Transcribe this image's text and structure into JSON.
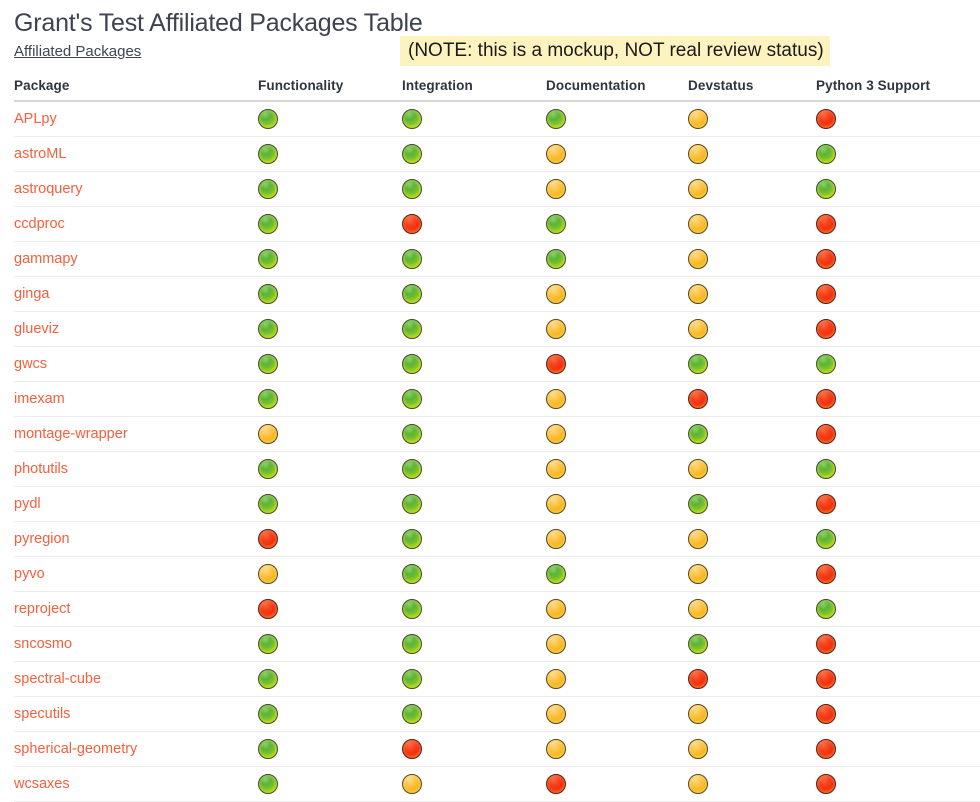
{
  "header": {
    "title": "Grant's Test Affiliated Packages Table",
    "breadcrumb_link": "Affiliated Packages",
    "note": "(NOTE: this is a mockup, NOT real review status)"
  },
  "colors": {
    "package_link": "#f4603e",
    "breadcrumb_link": "#3c4654",
    "note_background": "#fdf3bf",
    "green": "#6fc02c",
    "yellow": "#f5b31d",
    "red": "#ef2d0d",
    "header_rule": "#d6d6d6",
    "row_rule": "#ededed"
  },
  "table": {
    "columns": [
      "Package",
      "Functionality",
      "Integration",
      "Documentation",
      "Devstatus",
      "Python 3 Support"
    ],
    "rows": [
      {
        "package": "APLpy",
        "statuses": [
          "green",
          "green",
          "green",
          "yellow",
          "red"
        ]
      },
      {
        "package": "astroML",
        "statuses": [
          "green",
          "green",
          "yellow",
          "yellow",
          "green"
        ]
      },
      {
        "package": "astroquery",
        "statuses": [
          "green",
          "green",
          "yellow",
          "yellow",
          "green"
        ]
      },
      {
        "package": "ccdproc",
        "statuses": [
          "green",
          "red",
          "green",
          "yellow",
          "red"
        ]
      },
      {
        "package": "gammapy",
        "statuses": [
          "green",
          "green",
          "green",
          "yellow",
          "red"
        ]
      },
      {
        "package": "ginga",
        "statuses": [
          "green",
          "green",
          "yellow",
          "yellow",
          "red"
        ]
      },
      {
        "package": "glueviz",
        "statuses": [
          "green",
          "green",
          "yellow",
          "yellow",
          "red"
        ]
      },
      {
        "package": "gwcs",
        "statuses": [
          "green",
          "green",
          "red",
          "green",
          "green"
        ]
      },
      {
        "package": "imexam",
        "statuses": [
          "green",
          "green",
          "yellow",
          "red",
          "red"
        ]
      },
      {
        "package": "montage-wrapper",
        "statuses": [
          "yellow",
          "green",
          "yellow",
          "green",
          "red"
        ]
      },
      {
        "package": "photutils",
        "statuses": [
          "green",
          "green",
          "yellow",
          "yellow",
          "green"
        ]
      },
      {
        "package": "pydl",
        "statuses": [
          "green",
          "green",
          "yellow",
          "green",
          "red"
        ]
      },
      {
        "package": "pyregion",
        "statuses": [
          "red",
          "green",
          "yellow",
          "yellow",
          "green"
        ]
      },
      {
        "package": "pyvo",
        "statuses": [
          "yellow",
          "green",
          "green",
          "yellow",
          "red"
        ]
      },
      {
        "package": "reproject",
        "statuses": [
          "red",
          "green",
          "yellow",
          "yellow",
          "green"
        ]
      },
      {
        "package": "sncosmo",
        "statuses": [
          "green",
          "green",
          "yellow",
          "green",
          "red"
        ]
      },
      {
        "package": "spectral-cube",
        "statuses": [
          "green",
          "green",
          "yellow",
          "red",
          "red"
        ]
      },
      {
        "package": "specutils",
        "statuses": [
          "green",
          "green",
          "yellow",
          "yellow",
          "red"
        ]
      },
      {
        "package": "spherical-geometry",
        "statuses": [
          "green",
          "red",
          "yellow",
          "yellow",
          "red"
        ]
      },
      {
        "package": "wcsaxes",
        "statuses": [
          "green",
          "yellow",
          "red",
          "yellow",
          "red"
        ]
      }
    ]
  }
}
